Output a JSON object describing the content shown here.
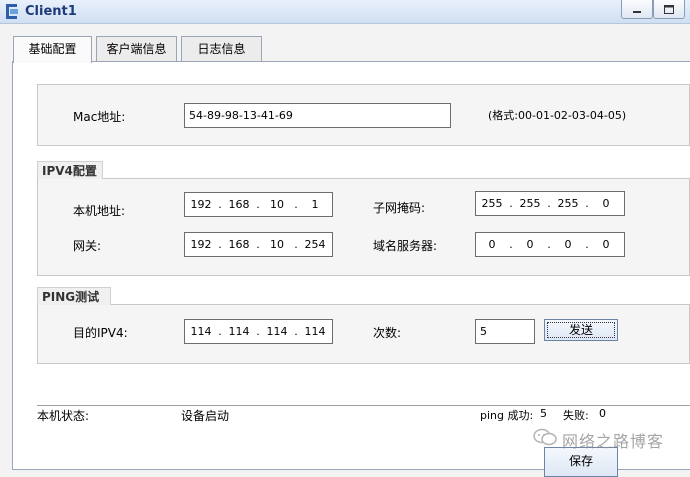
{
  "window": {
    "title": "Client1"
  },
  "tabs": [
    {
      "label": "基础配置"
    },
    {
      "label": "客户端信息"
    },
    {
      "label": "日志信息"
    }
  ],
  "mac": {
    "label": "Mac地址:",
    "value": "54-89-98-13-41-69",
    "format_hint": "(格式:00-01-02-03-04-05)"
  },
  "ipv4": {
    "legend": "IPV4配置",
    "host_ip_label": "本机地址:",
    "host_ip": [
      "192",
      "168",
      "10",
      "1"
    ],
    "subnet_label": "子网掩码:",
    "subnet": [
      "255",
      "255",
      "255",
      "0"
    ],
    "gateway_label": "网关:",
    "gateway": [
      "192",
      "168",
      "10",
      "254"
    ],
    "dns_label": "域名服务器:",
    "dns": [
      "0",
      "0",
      "0",
      "0"
    ]
  },
  "ping": {
    "legend": "PING测试",
    "dest_label": "目的IPV4:",
    "dest": [
      "114",
      "114",
      "114",
      "114"
    ],
    "count_label": "次数:",
    "count": "5",
    "send_label": "发送"
  },
  "status": {
    "label": "本机状态:",
    "value": "设备启动",
    "success_label": "ping 成功:",
    "success": "5",
    "fail_label": "失败:",
    "fail": "0"
  },
  "save_label": "保存",
  "watermark": "网络之路博客"
}
